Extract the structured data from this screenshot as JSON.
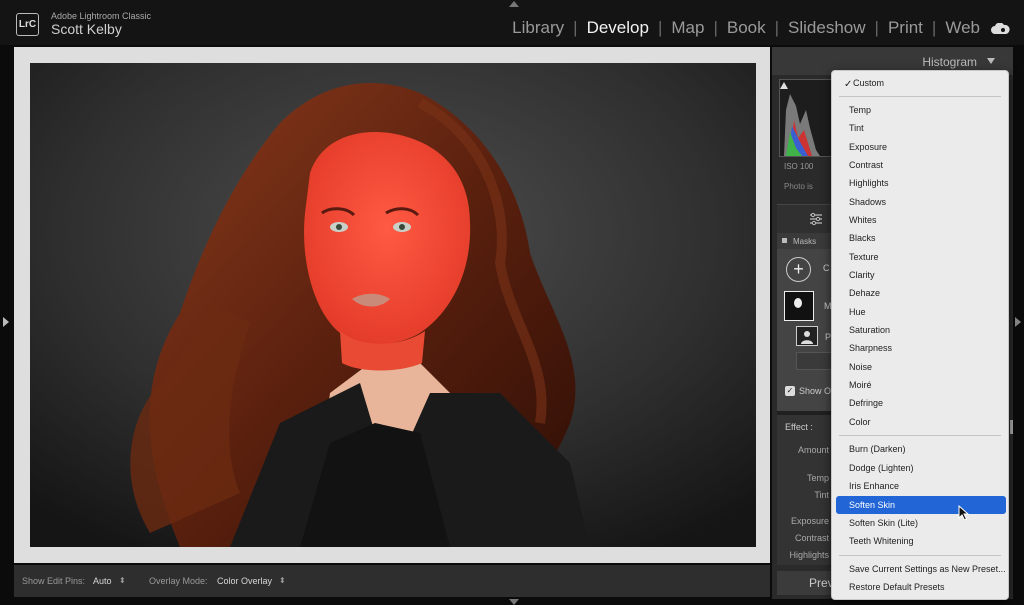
{
  "app": {
    "name": "Adobe Lightroom Classic",
    "logo": "LrC",
    "user": "Scott Kelby"
  },
  "modules": [
    "Library",
    "Develop",
    "Map",
    "Book",
    "Slideshow",
    "Print",
    "Web"
  ],
  "active_module": "Develop",
  "toolbar": {
    "edit_pins_label": "Show Edit Pins:",
    "edit_pins_value": "Auto",
    "overlay_mode_label": "Overlay Mode:",
    "overlay_mode_value": "Color Overlay"
  },
  "right_panel": {
    "histogram_title": "Histogram",
    "iso": "ISO 100",
    "photo_note": "Photo is",
    "masks_label": "Masks",
    "add_label": "C",
    "mask1_label": "M",
    "mask2_label": "P",
    "show_overlay_label": "Show O",
    "effect_label": "Effect :",
    "slider_labels": [
      "Amount",
      "Temp",
      "Tint",
      "Exposure",
      "Contrast",
      "Highlights"
    ],
    "preview_label": "Previ"
  },
  "dropdown": {
    "checked_item": "Custom",
    "group1": [
      "Temp",
      "Tint",
      "Exposure",
      "Contrast",
      "Highlights",
      "Shadows",
      "Whites",
      "Blacks",
      "Texture",
      "Clarity",
      "Dehaze",
      "Hue",
      "Saturation",
      "Sharpness",
      "Noise",
      "Moiré",
      "Defringe",
      "Color"
    ],
    "group2": [
      "Burn (Darken)",
      "Dodge (Lighten)",
      "Iris Enhance",
      "Soften Skin",
      "Soften Skin (Lite)",
      "Teeth Whitening"
    ],
    "group3": [
      "Save Current Settings as New Preset...",
      "Restore Default Presets"
    ],
    "selected_item": "Soften Skin"
  },
  "colors": {
    "menu_highlight": "#2165d6",
    "mask_overlay": "#ff3a2a",
    "background": "#0b0b0b"
  }
}
